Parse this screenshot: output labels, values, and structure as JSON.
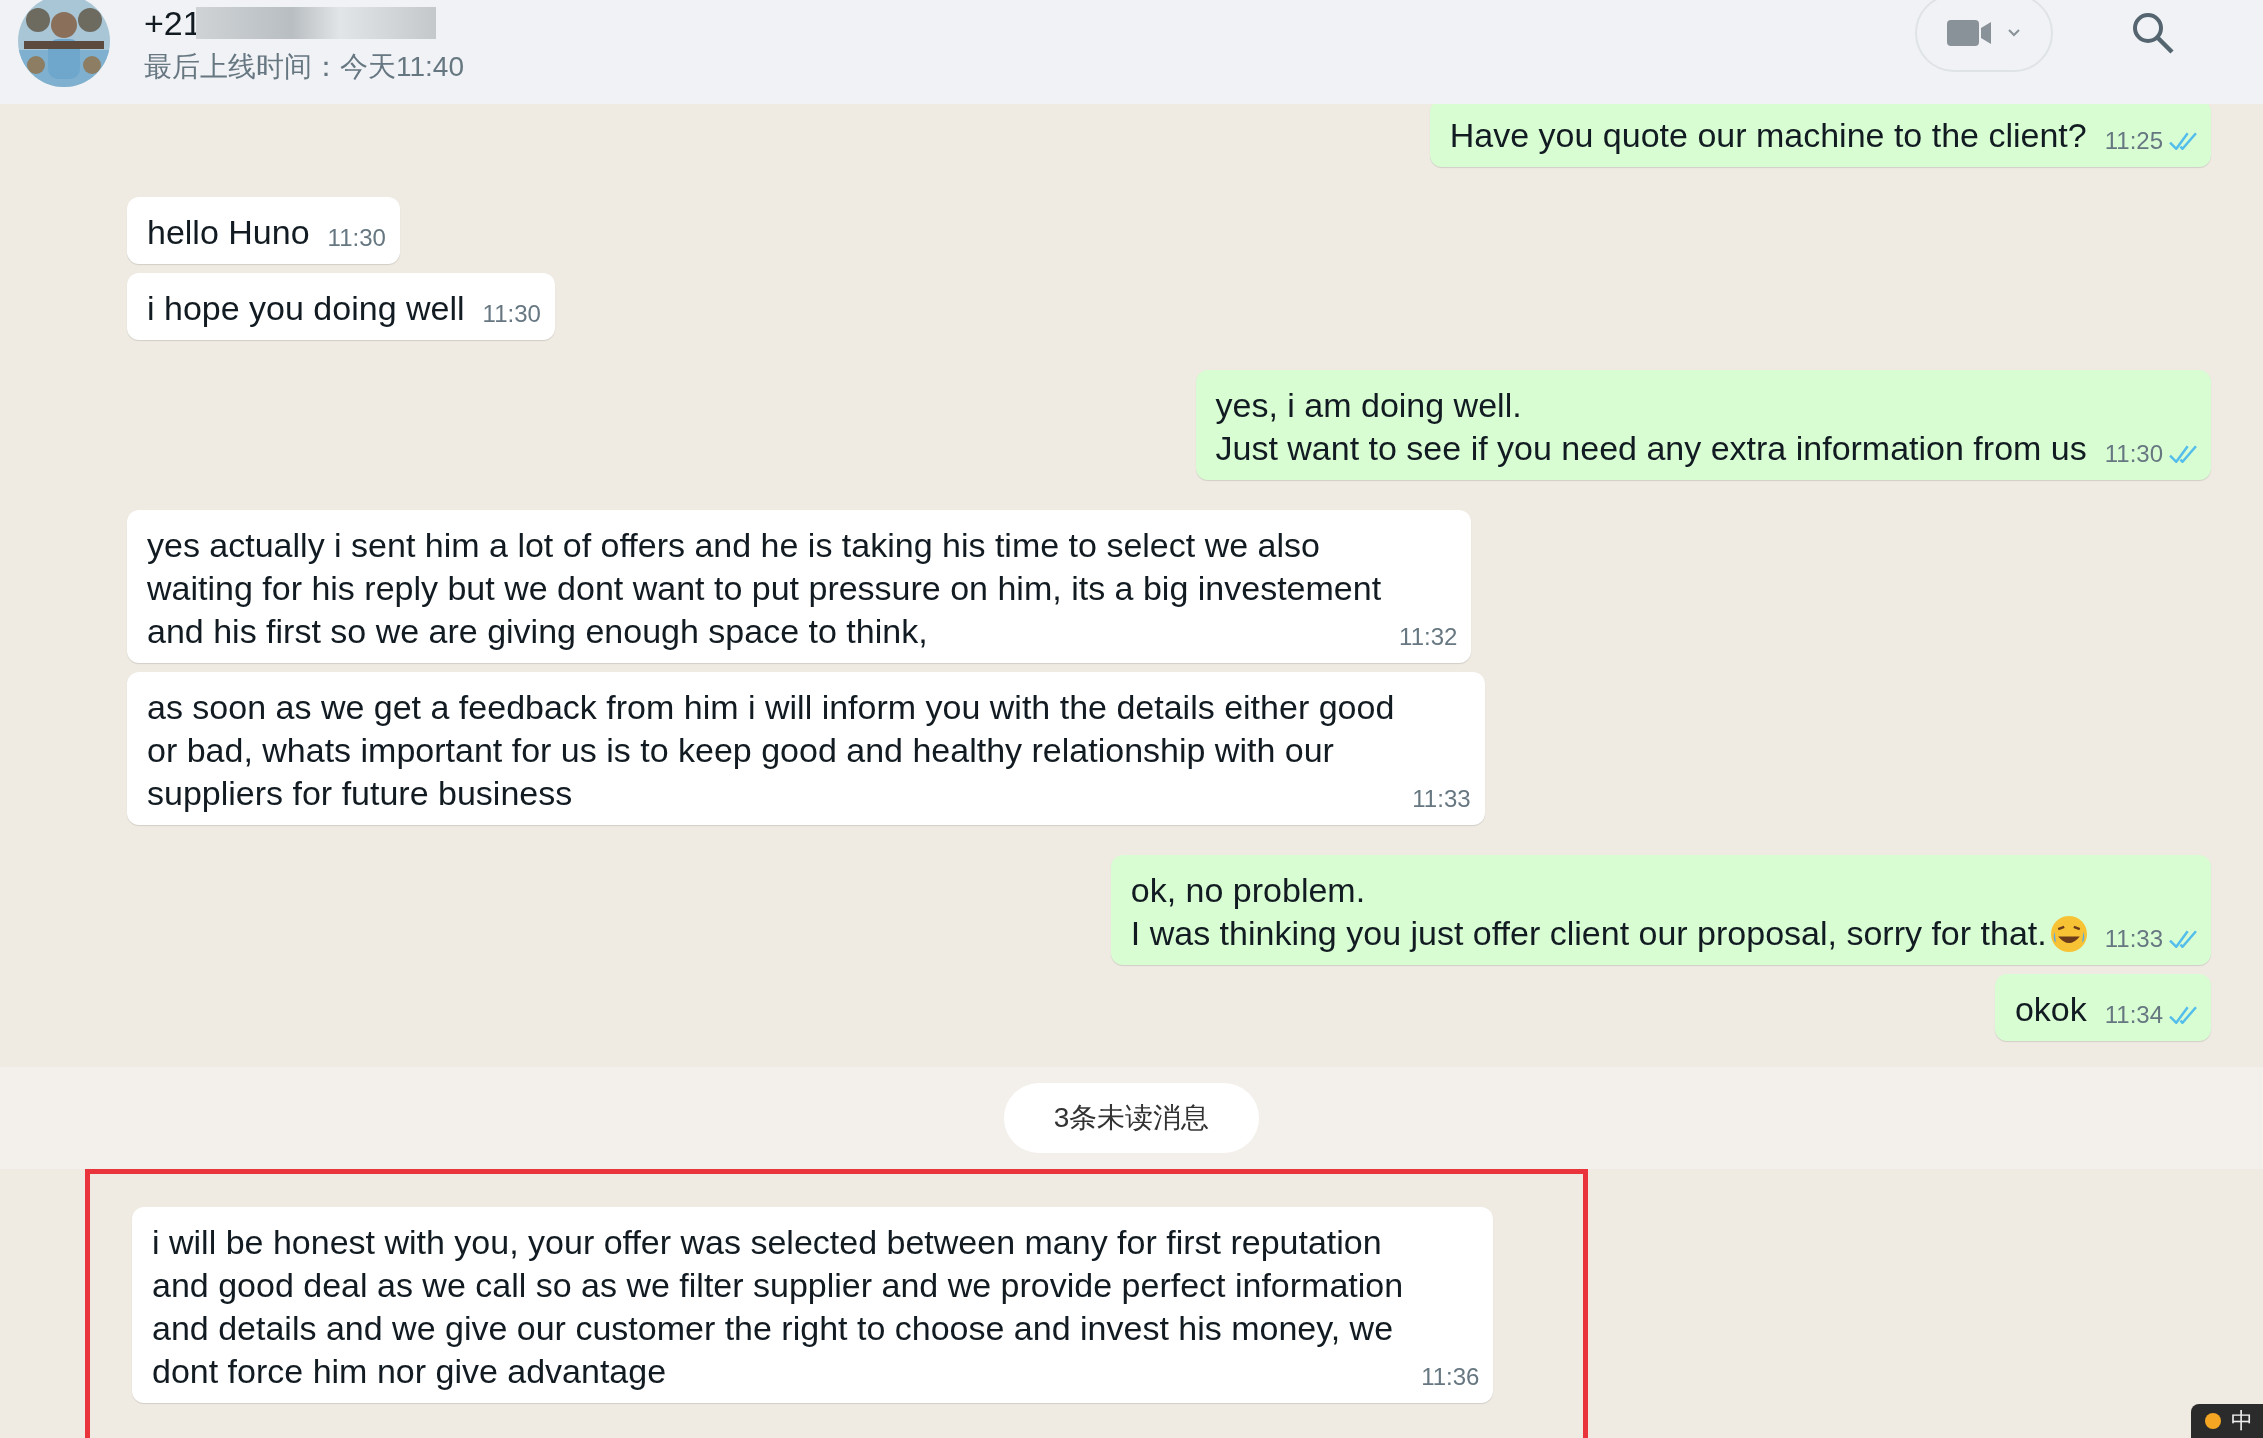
{
  "header": {
    "name": "+21",
    "last_seen": "最后上线时间：今天11:40"
  },
  "messages": [
    {
      "kind": "outgoing",
      "lines": [
        "Have you quote our machine to the client?"
      ],
      "time": "11:25",
      "read": true
    },
    {
      "kind": "incoming",
      "lines": [
        "hello Huno"
      ],
      "time": "11:30",
      "group_start": true
    },
    {
      "kind": "incoming",
      "lines": [
        "i hope you doing well"
      ],
      "time": "11:30"
    },
    {
      "kind": "outgoing",
      "lines": [
        "yes, i am doing well.",
        "Just want to see if you need any extra information from us"
      ],
      "time": "11:30",
      "read": true,
      "group_start": true
    },
    {
      "kind": "incoming",
      "lines": [
        "yes actually i sent him a lot of offers and he is taking his time to select we also",
        "waiting for his reply but we dont want to put pressure on him, its a big investement",
        "and his first so we are giving enough space to think,"
      ],
      "time": "11:32",
      "group_start": true
    },
    {
      "kind": "incoming",
      "lines": [
        "as soon as we get a feedback from him i will inform you with the details either good",
        "or bad, whats important for us is to keep good and healthy relationship with our",
        "suppliers for future business"
      ],
      "time": "11:33"
    },
    {
      "kind": "outgoing",
      "lines": [
        "ok, no problem.",
        "I was thinking you just offer client our proposal, sorry for that."
      ],
      "time": "11:33",
      "read": true,
      "emoji_after": true,
      "group_start": true
    },
    {
      "kind": "outgoing",
      "lines": [
        "okok"
      ],
      "time": "11:34",
      "read": true
    },
    {
      "kind": "divider",
      "text": "3条未读消息"
    },
    {
      "kind": "incoming",
      "lines": [
        "i will be honest with you, your offer was selected between many for first reputation",
        "and good deal as we call so as we filter supplier and we provide perfect information",
        "and details and we give our customer the right to choose and invest his money, we",
        "dont force him nor give advantage"
      ],
      "time": "11:36",
      "highlighted": true
    }
  ],
  "ime_indicator": "中"
}
